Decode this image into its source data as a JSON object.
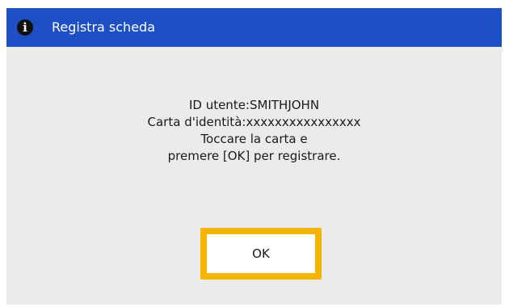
{
  "header": {
    "title": "Registra scheda",
    "icon": "info-icon",
    "background_color": "#1f4fc4"
  },
  "message": {
    "user_id_label": "ID utente:",
    "user_id_value": "SMITHJOHN",
    "card_label": "Carta d'identità:",
    "card_value": "xxxxxxxxxxxxxxxx",
    "instruction_line1": "Toccare la carta e",
    "instruction_line2": "premere [OK] per registrare."
  },
  "buttons": {
    "ok_label": "OK",
    "ok_highlight_color": "#f5b400"
  }
}
